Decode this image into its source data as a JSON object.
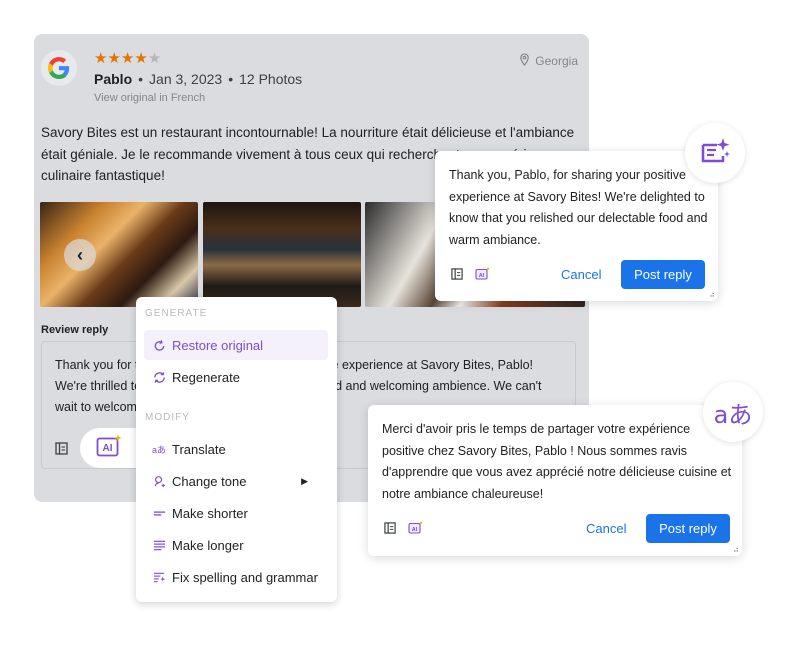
{
  "review": {
    "rating": 4,
    "max_rating": 5,
    "stars": [
      "★",
      "★",
      "★",
      "★",
      "★"
    ],
    "reviewer_name": "Pablo",
    "date": "Jan 3, 2023",
    "photos_count": "12 Photos",
    "view_original": "View original in French",
    "location": "Georgia",
    "text": "Savory Bites est un restaurant incontournable! La nourriture était délicieuse et l'ambiance était géniale. Je le recommande vivement à tous ceux qui recherchent une expérience culinaire fantastique!",
    "prev_photo": "‹"
  },
  "reply": {
    "label": "Review reply",
    "text": "Thank you for taking the time to share your positive experience at Savory Bites, Pablo! We're thrilled to hear you enjoyed our delicious food and welcoming ambience. We can't wait to welcome you back!"
  },
  "menu": {
    "generate_header": "GENERATE",
    "modify_header": "MODIFY",
    "items": [
      {
        "label": "Restore original",
        "icon": "restore-icon"
      },
      {
        "label": "Regenerate",
        "icon": "regenerate-icon"
      },
      {
        "label": "Translate",
        "icon": "translate-icon"
      },
      {
        "label": "Change tone",
        "icon": "change-tone-icon"
      },
      {
        "label": "Make shorter",
        "icon": "make-shorter-icon"
      },
      {
        "label": "Make longer",
        "icon": "make-longer-icon"
      },
      {
        "label": "Fix spelling and grammar",
        "icon": "fix-spelling-icon"
      }
    ]
  },
  "popup_english": {
    "text": "Thank you, Pablo, for sharing your positive experience at Savory Bites! We're delighted to know that you relished our delectable food and warm ambiance.",
    "cancel": "Cancel",
    "post": "Post reply"
  },
  "popup_french": {
    "text": "Merci d'avoir pris le temps de partager votre expérience positive chez Savory Bites, Pablo ! Nous sommes ravis d'apprendre que vous avez apprécié notre délicieuse cuisine et notre ambiance chaleureuse!",
    "cancel": "Cancel",
    "post": "Post reply"
  },
  "ai_label": "AI",
  "translate_glyph": "aあ",
  "colors": {
    "accent": "#7d4dd2",
    "primary": "#1a73e8",
    "star": "#e37400",
    "card_bg": "#dadce0"
  }
}
